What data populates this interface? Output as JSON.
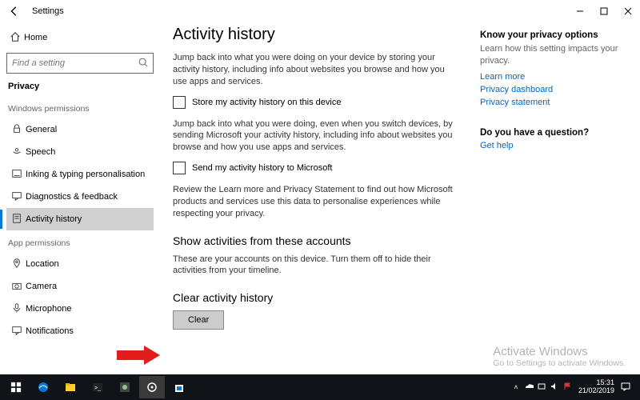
{
  "titlebar": {
    "title": "Settings"
  },
  "sidebar": {
    "home": "Home",
    "search_placeholder": "Find a setting",
    "current": "Privacy",
    "group_win": "Windows permissions",
    "items_win": [
      {
        "label": "General"
      },
      {
        "label": "Speech"
      },
      {
        "label": "Inking & typing personalisation"
      },
      {
        "label": "Diagnostics & feedback"
      },
      {
        "label": "Activity history"
      }
    ],
    "group_app": "App permissions",
    "items_app": [
      {
        "label": "Location"
      },
      {
        "label": "Camera"
      },
      {
        "label": "Microphone"
      },
      {
        "label": "Notifications"
      }
    ]
  },
  "main": {
    "heading": "Activity history",
    "para1": "Jump back into what you were doing on your device by storing your activity history, including info about websites you browse and how you use apps and services.",
    "check1": "Store my activity history on this device",
    "para2": "Jump back into what you were doing, even when you switch devices, by sending Microsoft your activity history, including info about websites you browse and how you use apps and services.",
    "check2": "Send my activity history to Microsoft",
    "para3": "Review the Learn more and Privacy Statement to find out how Microsoft products and services use this data to personalise experiences while respecting your privacy.",
    "h2a": "Show activities from these accounts",
    "para4": "These are your accounts on this device. Turn them off to hide their activities from your timeline.",
    "h2b": "Clear activity history",
    "clear_btn": "Clear"
  },
  "right": {
    "h1": "Know your privacy options",
    "sub1": "Learn how this setting impacts your privacy.",
    "links1": [
      "Learn more",
      "Privacy dashboard",
      "Privacy statement"
    ],
    "h2": "Do you have a question?",
    "link2": "Get help"
  },
  "watermark": {
    "t1": "Activate Windows",
    "t2": "Go to Settings to activate Windows."
  },
  "taskbar": {
    "time": "15:31",
    "date": "21/02/2019"
  }
}
